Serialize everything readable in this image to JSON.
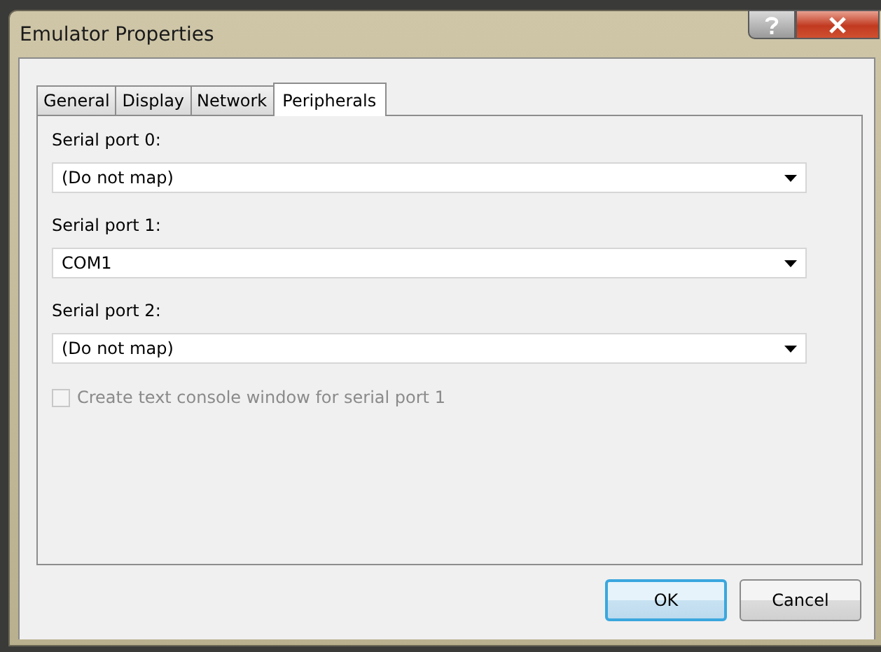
{
  "window": {
    "title": "Emulator Properties"
  },
  "tabs": [
    {
      "label": "General",
      "selected": false
    },
    {
      "label": "Display",
      "selected": false
    },
    {
      "label": "Network",
      "selected": false
    },
    {
      "label": "Peripherals",
      "selected": true
    }
  ],
  "ports": [
    {
      "label": "Serial port 0:",
      "value": "(Do not map)"
    },
    {
      "label": "Serial port 1:",
      "value": "COM1"
    },
    {
      "label": "Serial port 2:",
      "value": "(Do not map)"
    }
  ],
  "console_checkbox": {
    "label": "Create text console window for serial port 1",
    "checked": false,
    "disabled": true
  },
  "buttons": [
    {
      "label": "OK",
      "default": true
    },
    {
      "label": "Cancel",
      "default": false
    }
  ]
}
